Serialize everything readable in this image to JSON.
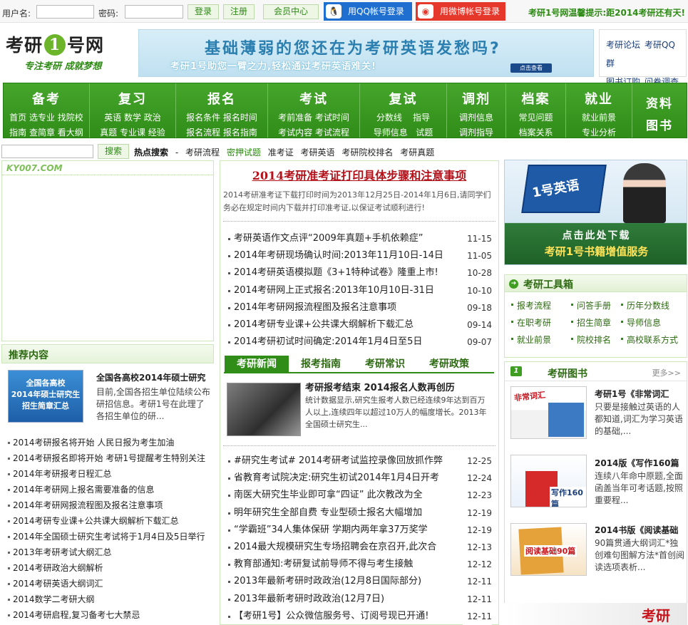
{
  "login": {
    "username_label": "用户名:",
    "password_label": "密码:",
    "login_btn": "登录",
    "register_btn": "注册",
    "member_btn": "会员中心",
    "qq_login": "用QQ帐号登录",
    "weibo_login": "用微博帐号登录",
    "notice": "考研1号网温馨提示:距2014考研还有天!"
  },
  "logo": {
    "part1": "考研",
    "one": "1",
    "part2": "号网",
    "slogan": "专注考研 成就梦想"
  },
  "banner": {
    "line1": "基础薄弱的您还在为考研英语发愁吗?",
    "line2": "考研1号助您一臂之力,轻松通过考研英语难关!",
    "button": "点击查看"
  },
  "quick_links": [
    "考研论坛",
    "考研QQ群",
    "图书订购",
    "问卷调查"
  ],
  "nav": [
    {
      "title": "备考",
      "row1": "首页 选专业 找院校",
      "row2": "指南 查简章 看大纲"
    },
    {
      "title": "复习",
      "row1": "英语 数学 政治",
      "row2": "真题 专业课 经验"
    },
    {
      "title": "报名",
      "row1": "报名条件 报名时间",
      "row2": "报名流程 报名指南"
    },
    {
      "title": "考试",
      "row1": "考前准备 考试时间",
      "row2": "考试内容 考试流程"
    },
    {
      "title": "复试",
      "row1": "分数线    指导",
      "row2": "导师信息   试题"
    },
    {
      "title": "调剂",
      "row1": "调剂信息",
      "row2": "调剂指导"
    },
    {
      "title": "档案",
      "row1": "常见问题",
      "row2": "档案关系"
    },
    {
      "title": "就业",
      "row1": "就业前景",
      "row2": "专业分析"
    },
    {
      "title": "资料",
      "row1": "图书",
      "row2": ""
    }
  ],
  "search": {
    "button": "搜索",
    "hot_label": "热点搜索",
    "hot_sep": "-",
    "hot_items": [
      "考研流程",
      "密押试题",
      "准考证",
      "考研英语",
      "考研院校排名",
      "考研真题"
    ]
  },
  "left": {
    "watermark": "KY007.COM",
    "rec_title": "推荐内容",
    "rec_img_lines": [
      "全国各高校",
      "2014年硕士研究生",
      "招生简章汇总"
    ],
    "rec_item_title": "全国各高校2014年硕士研究",
    "rec_item_desc": "目前,全国各招生单位陆续公布研招信息。考研1号在此理了各招生单位的研...",
    "list": [
      "2014考研报名将开始 人民日报为考生加油",
      "2014考研报名即将开始 考研1号提醒考生特别关注",
      "2014年考研报考日程汇总",
      "2014年考研网上报名需要准备的信息",
      "2014年考研网报流程图及报名注意事项",
      "2014考研专业课+公共课大纲解析下载汇总",
      "2014年全国硕士研究生考试将于1月4日及5日举行",
      "2013年考研考试大纲汇总",
      "2014考研政治大纲解析",
      "2014考研英语大纲词汇",
      "2014数学二考研大纲",
      "2014考研启程,复习备考七大禁忌"
    ]
  },
  "center": {
    "headline": "2014考研准考证打印具体步骤和注意事项",
    "summary": "2014考研准考证下载打印时间为2013年12月25日-2014年1月6日,请同学们务必在规定时间内下载并打印准考证,以保证考试顺利进行!",
    "news1": [
      {
        "t": "考研英语作文点评“2009年真题+手机依赖症”",
        "d": "11-15"
      },
      {
        "t": "2014年考研现场确认时间:2013年11月10日-14日",
        "d": "11-05"
      },
      {
        "t": "2014考研英语模拟题《3+1特种试卷》隆重上市!",
        "d": "10-28"
      },
      {
        "t": "2014考研网上正式报名:2013年10月10日-31日",
        "d": "10-10"
      },
      {
        "t": "2014年考研网报流程图及报名注意事项",
        "d": "09-18"
      },
      {
        "t": "2014考研专业课+公共课大纲解析下载汇总",
        "d": "09-14"
      },
      {
        "t": "2014考研初试时间确定:2014年1月4日至5日",
        "d": "09-07"
      }
    ],
    "tabs": [
      "考研新闻",
      "报考指南",
      "考研常识",
      "考研政策"
    ],
    "feature_title": "考研报考结束 2014报名人数再创历",
    "feature_desc": "统计数据显示,研究生报考人数已经连续9年达到百万人以上,连续四年以超过10万人的幅度增长。2013年全国硕士研究生...",
    "news2": [
      {
        "t": "#研究生考试# 2014考研考试监控录像回放抓作弊",
        "d": "12-25"
      },
      {
        "t": "省教育考试院决定:研究生初试2014年1月4日开考",
        "d": "12-24"
      },
      {
        "t": "南医大研究生毕业即可拿“四证” 此次教改为全",
        "d": "12-23"
      },
      {
        "t": "明年研究生全部自费 专业型硕士报名大幅增加",
        "d": "12-19"
      },
      {
        "t": "“学霸班”34人集体保研 学期内两年拿37万奖学",
        "d": "12-19"
      },
      {
        "t": "2014最大规模研究生专场招聘会在京召开,此次合",
        "d": "12-13"
      },
      {
        "t": "教育部通知:考研复试前导师不得与考生接触",
        "d": "12-12"
      },
      {
        "t": "2013年最新考研时政政治(12月8日国际部分)",
        "d": "12-11"
      },
      {
        "t": "2013年最新考研时政政治(12月7日)",
        "d": "12-11"
      },
      {
        "t": "【考研1号】公众微信服务号、订阅号现已开通!",
        "d": "12-11"
      }
    ]
  },
  "right": {
    "ad_book": "1号英语",
    "ad_line1": "点击此处下载",
    "ad_line2": "考研1号书籍增值服务",
    "tools_title": "考研工具箱",
    "tools": [
      "报考流程",
      "问答手册",
      "历年分数线",
      "在职考研",
      "招生简章",
      "导师信息",
      "就业前景",
      "院校排名",
      "高校联系方式"
    ],
    "books_title": "考研图书",
    "books_more": "更多>>",
    "books": [
      {
        "title": "考研1号《非常词汇",
        "desc": "只要是接触过英语的人都知道,词汇为学习英语的基础,...",
        "cover": "非常词汇"
      },
      {
        "title": "2014版《写作160篇",
        "desc": "连续八年命中原题,全面函盖当年可考话题,按照重要程...",
        "cover": "写作160篇"
      },
      {
        "title": "2014书版《阅读基础",
        "desc": "90篇贯通大纲词汇*独创难句图解方法*首创阅读选项表析...",
        "cover": "阅读基础90篇"
      }
    ],
    "bottom_tag": "考研"
  },
  "colors": {
    "brand_green": "#2f8d18",
    "headline_red": "#b3121b",
    "qq_blue": "#1e6fd0",
    "weibo_red": "#e6372b"
  }
}
